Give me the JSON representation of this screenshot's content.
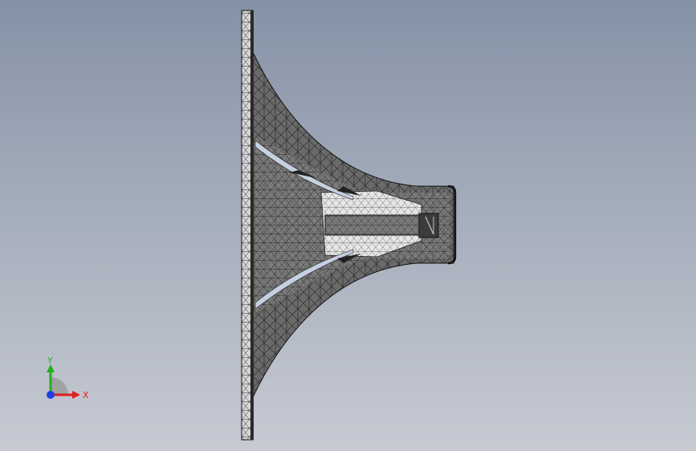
{
  "viewport": {
    "background_top": "#8592a6",
    "background_bottom": "#c7cad3"
  },
  "model": {
    "description_icon": "horn-speaker-mesh-icon",
    "mesh_fill": "#6e6e6e",
    "mesh_dark": "#2a2a2a",
    "flange_fill": "#cfcfcf",
    "line_color": "#111111"
  },
  "triad": {
    "x_label": "X",
    "y_label": "Y",
    "x_color": "#e02020",
    "y_color": "#20b020",
    "z_color": "#2040e0"
  }
}
